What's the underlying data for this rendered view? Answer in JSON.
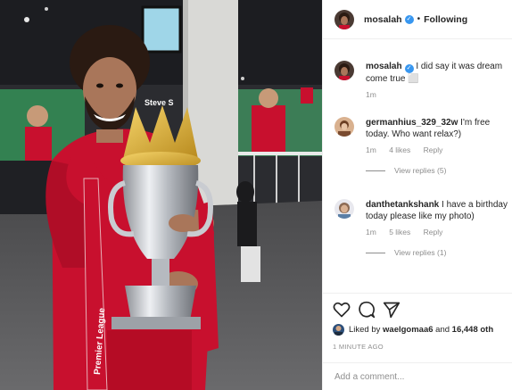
{
  "post": {
    "author": "mosalah",
    "follow_label": "Following",
    "separator": "•",
    "caption": {
      "username": "mosalah",
      "text": "I did say it was dream come true ⬜",
      "time": "1m"
    }
  },
  "photo": {
    "banner_text": "Premier League",
    "wall_name": "Steve S"
  },
  "comments": [
    {
      "username": "germanhius_329_32w",
      "text": "I'm free today. Who want relax?)",
      "time": "1m",
      "likes": "4 likes",
      "reply_label": "Reply",
      "view_replies": "View replies (5)"
    },
    {
      "username": "danthetankshank",
      "text": "I have a birthday today please like my photo)",
      "time": "1m",
      "likes": "5 likes",
      "reply_label": "Reply",
      "view_replies": "View replies (1)"
    }
  ],
  "likes_summary": {
    "prefix": "Liked by",
    "user": "waelgomaa6",
    "conjunction": "and",
    "others": "16,448 oth"
  },
  "timestamp": "1 MINUTE AGO",
  "add_comment": {
    "placeholder": "Add a comment..."
  },
  "icons": {
    "verified": "verified-badge-icon",
    "like": "heart-icon",
    "comment": "comment-icon",
    "share": "share-icon"
  },
  "colors": {
    "verified_blue": "#3897f0",
    "secondary_text": "#8e8e8e",
    "liverpool_red": "#c8102e"
  }
}
